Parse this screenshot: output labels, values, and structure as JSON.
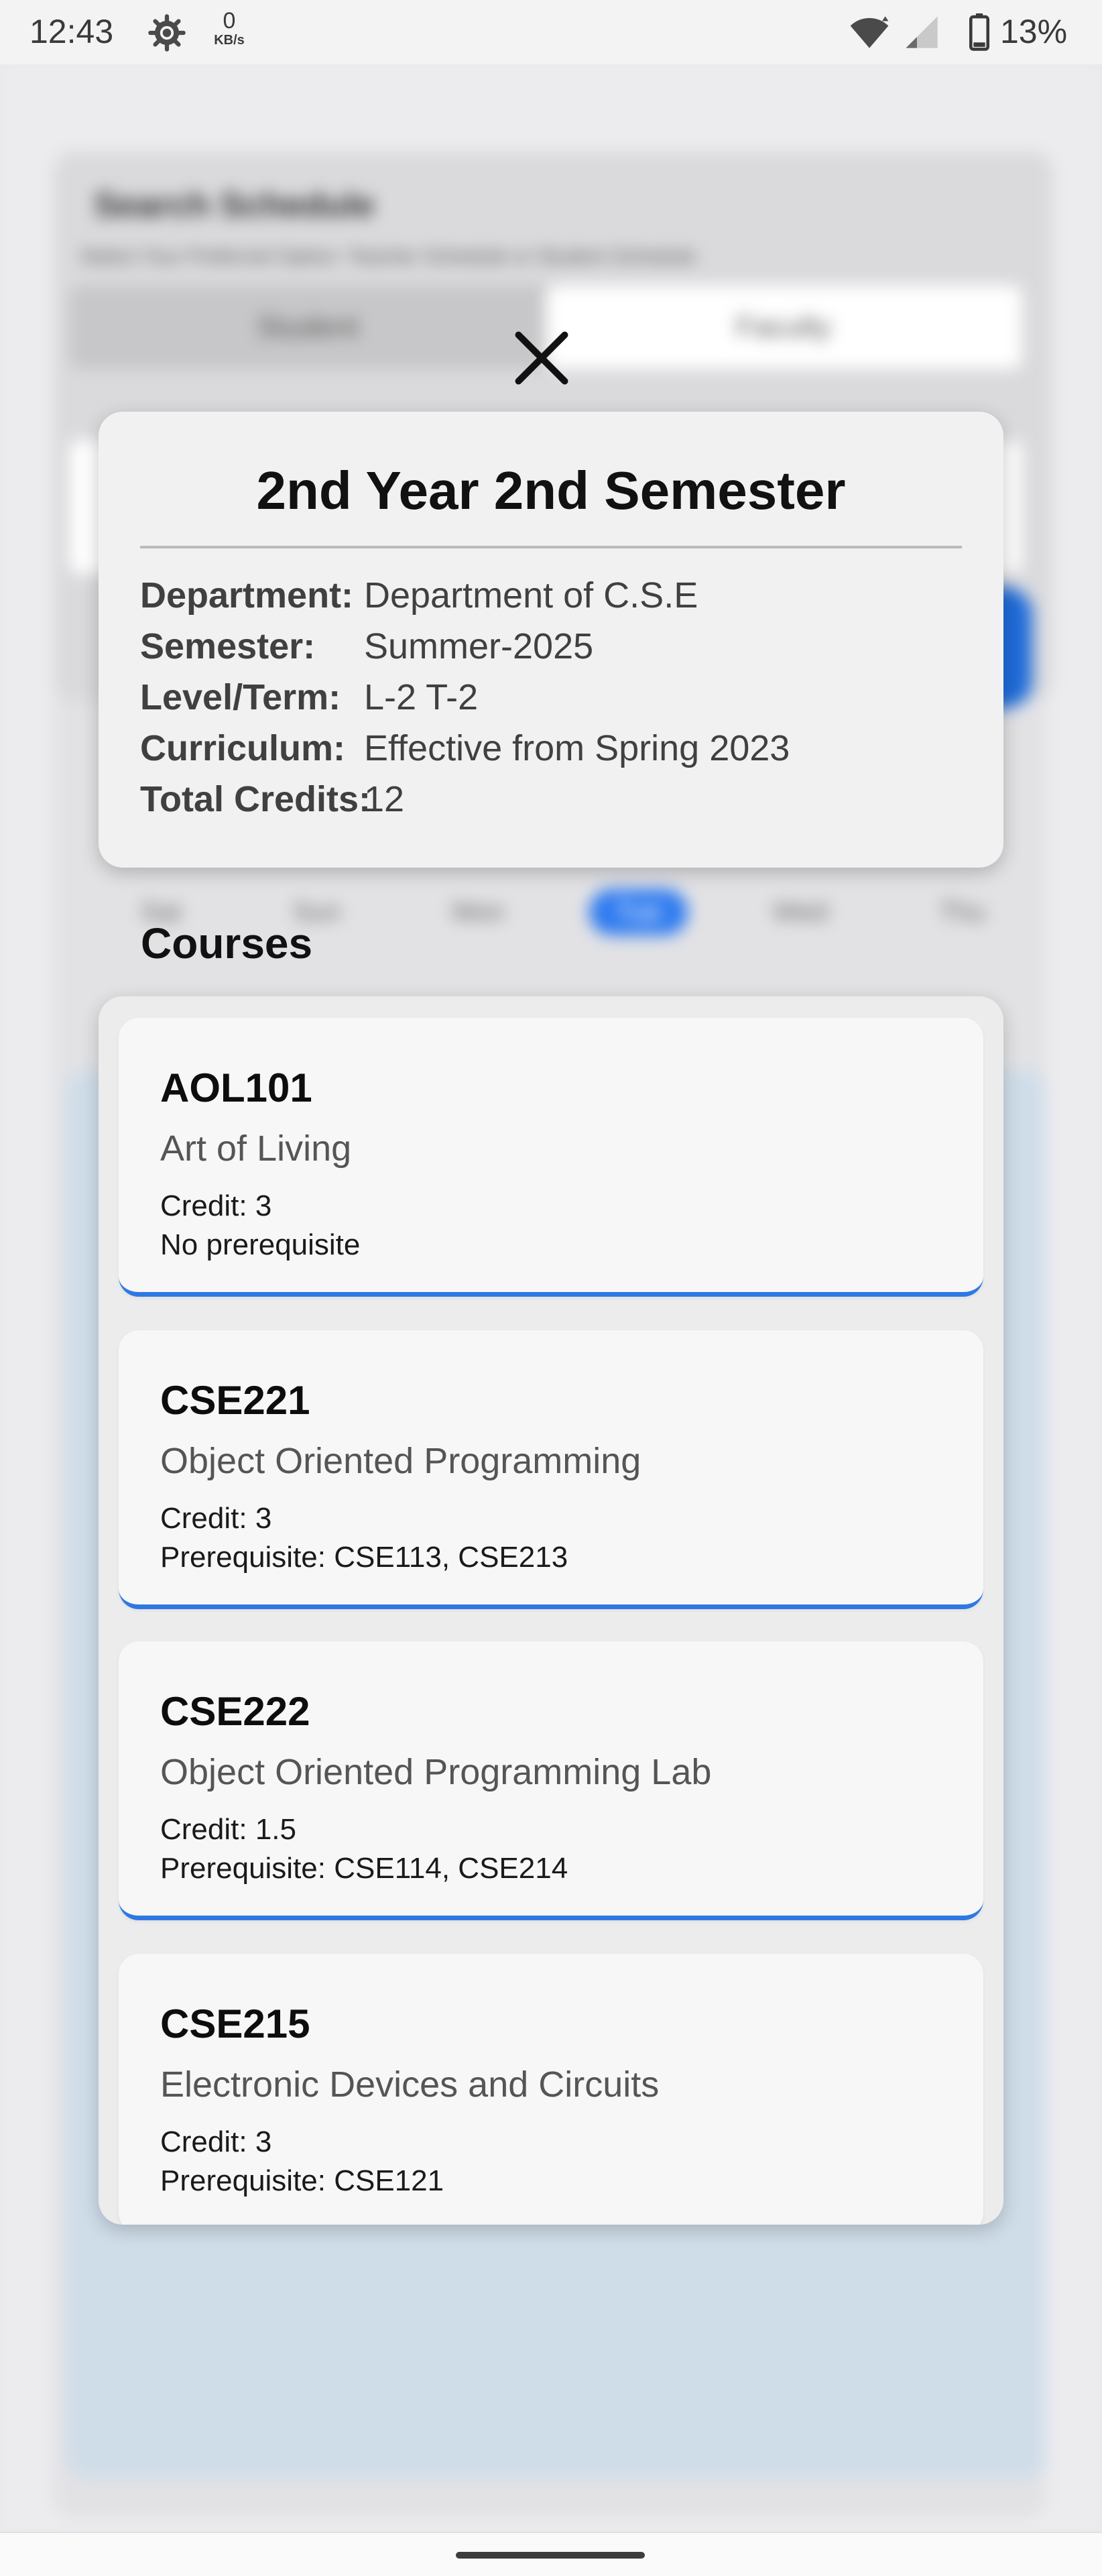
{
  "status_bar": {
    "time": "12:43",
    "net_speed_value": "0",
    "net_speed_unit": "KB/s",
    "battery": "13%",
    "icons": [
      "gear-icon",
      "wifi-icon",
      "signal-icon",
      "battery-icon"
    ]
  },
  "background": {
    "title": "Search Schedule",
    "subtitle": "Select Your Preferred Option: Teacher Schedule or Student Schedule",
    "tabs": [
      "Student",
      "Faculty"
    ],
    "days": [
      "Sat",
      "Sun",
      "Mon",
      "Tue",
      "Wed",
      "Thu"
    ],
    "active_day": "Tue"
  },
  "modal": {
    "title": "2nd Year 2nd Semester",
    "info": [
      {
        "label": "Department:",
        "value": "Department of C.S.E"
      },
      {
        "label": "Semester:",
        "value": "Summer-2025"
      },
      {
        "label": "Level/Term:",
        "value": "L-2 T-2"
      },
      {
        "label": "Curriculum:",
        "value": "Effective from Spring 2023"
      },
      {
        "label": "Total Credits:",
        "value": "12"
      }
    ],
    "courses_heading": "Courses",
    "courses": [
      {
        "code": "AOL101",
        "name": "Art of Living",
        "credit": "Credit: 3",
        "prereq": "No prerequisite"
      },
      {
        "code": "CSE221",
        "name": "Object Oriented Programming",
        "credit": "Credit: 3",
        "prereq": "Prerequisite: CSE113, CSE213"
      },
      {
        "code": "CSE222",
        "name": "Object Oriented Programming Lab",
        "credit": "Credit: 1.5",
        "prereq": "Prerequisite: CSE114, CSE214"
      },
      {
        "code": "CSE215",
        "name": "Electronic Devices and Circuits",
        "credit": "Credit: 3",
        "prereq": "Prerequisite: CSE121"
      }
    ]
  },
  "colors": {
    "accent": "#2f78e4",
    "card_bg": "#f7f7f7",
    "panel_bg": "#ececec"
  }
}
